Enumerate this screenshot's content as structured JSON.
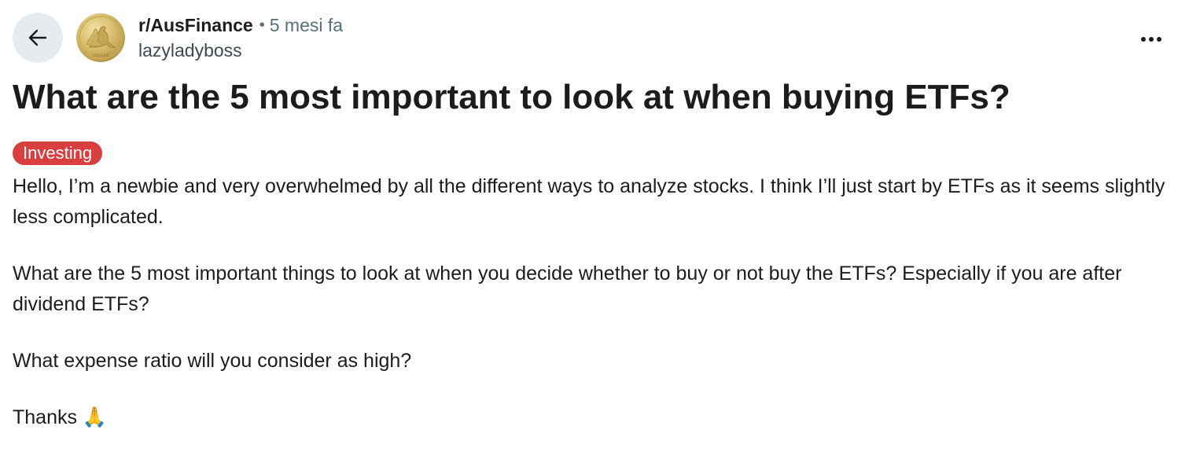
{
  "header": {
    "subreddit": "r/AusFinance",
    "separator": "•",
    "time_ago": "5 mesi fa",
    "username": "lazyladyboss"
  },
  "icons": {
    "back": "arrow-left-icon",
    "more": "more-horizontal-icon",
    "avatar": "gold-coin-kangaroo-avatar"
  },
  "post": {
    "title": "What are the 5 most important to look at when buying ETFs?",
    "flair": "Investing",
    "paragraphs": [
      "Hello, I’m a newbie and very overwhelmed by all the different ways to analyze stocks. I think I’ll just start by ETFs as it seems slightly less complicated.",
      "What are the 5 most important things to look at when you decide whether to buy or not buy the ETFs? Especially if you are after dividend ETFs?",
      "What expense ratio will you consider as high?",
      "Thanks 🙏"
    ]
  },
  "colors": {
    "flair_bg": "#d93f3f",
    "back_button_bg": "#e5ebee",
    "meta_text": "#576f76",
    "text": "#1c1c1c"
  }
}
